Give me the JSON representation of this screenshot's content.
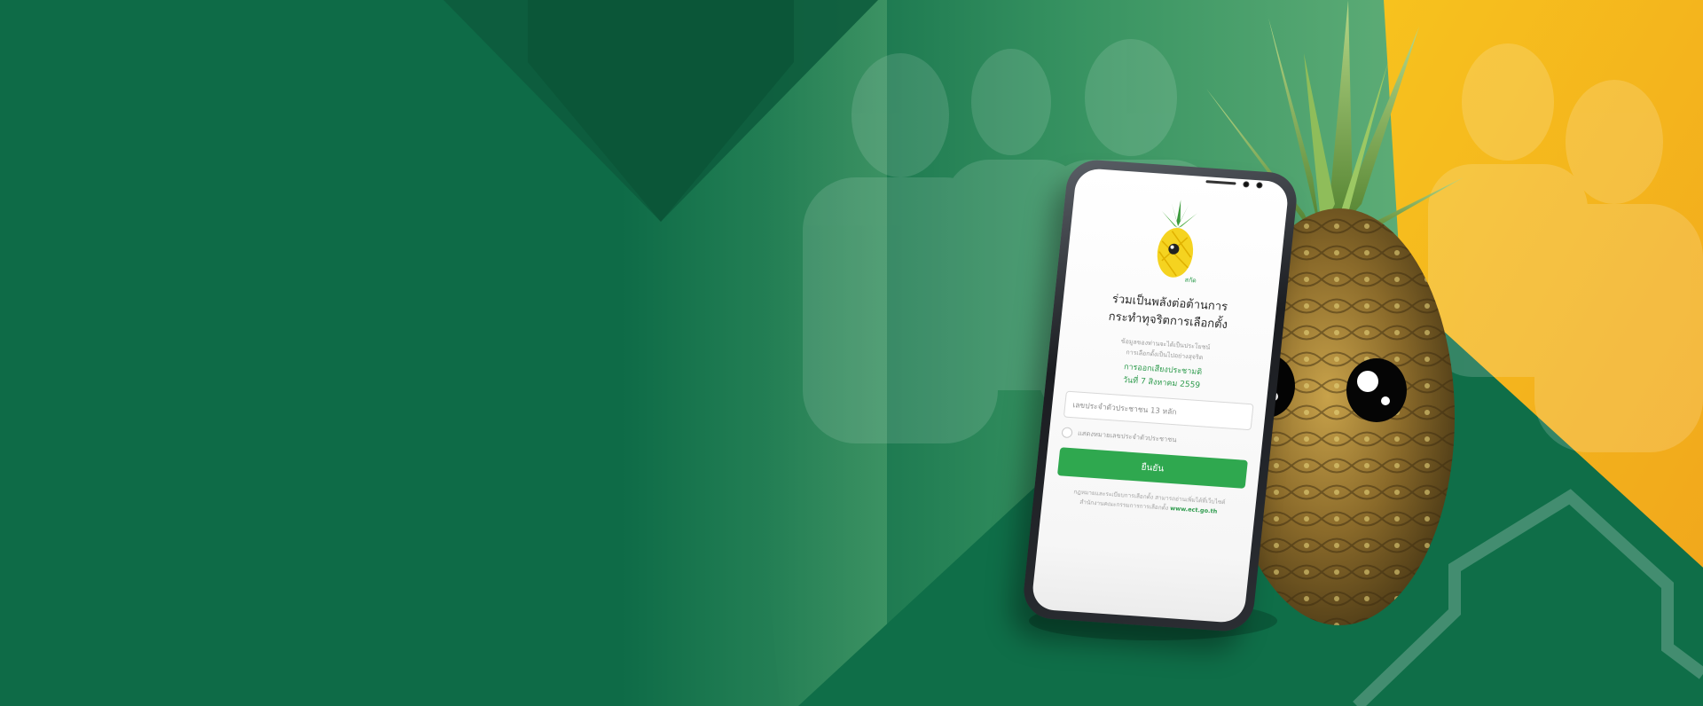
{
  "colors": {
    "brand_green": "#0e6b47",
    "dark_green": "#0b5a3b",
    "light_green": "#63b77a",
    "accent_yellow": "#f2b01e",
    "button_green": "#2fa84f"
  },
  "phone": {
    "logo_caption": "สกัด",
    "headline_line1": "ร่วมเป็นพลังต่อต้านการ",
    "headline_line2": "กระทำทุจริตการเลือกตั้ง",
    "subtext_line1": "ข้อมูลของท่านจะได้เป็นประโยชน์",
    "subtext_line2": "การเลือกตั้งเป็นไปอย่างสุจริต",
    "vote_line1": "การออกเสียงประชามติ",
    "vote_line2": "วันที่ 7 สิงหาคม 2559",
    "id_placeholder": "เลขประจำตัวประชาชน 13 หลัก",
    "hide_id_label": "แสดงหมายเลขประจำตัวประชาชน",
    "confirm_label": "ยืนยัน",
    "footnote_line1": "กฎหมายและระเบียบการเลือกตั้ง สามารถอ่านเพิ่มได้ที่เว็บไซต์",
    "footnote_line2": "สำนักงานคณะกรรมการการเลือกตั้ง",
    "footnote_link": "www.ect.go.th"
  },
  "icons": {
    "pineapple_logo": "pineapple-logo-icon",
    "pineapple_mascot": "pineapple-mascot-icon"
  }
}
